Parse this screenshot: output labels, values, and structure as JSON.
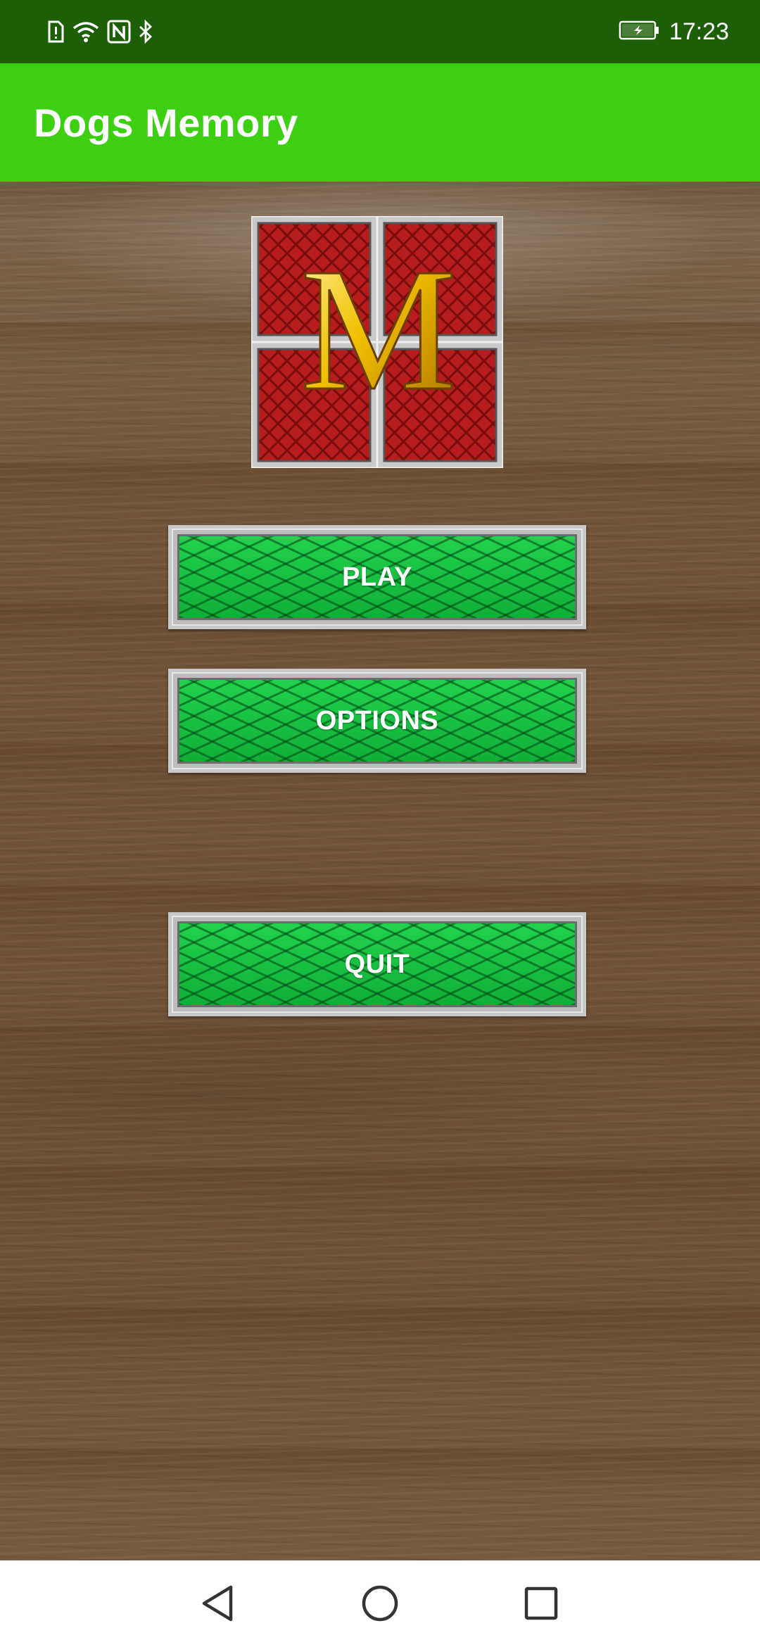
{
  "status_bar": {
    "time": "17:23",
    "icons": [
      "sim-alert-icon",
      "wifi-icon",
      "nfc-icon",
      "bluetooth-icon",
      "battery-charging-icon"
    ],
    "background_color": "#1d5f06"
  },
  "app_bar": {
    "title": "Dogs Memory",
    "background_color": "#3ccf12"
  },
  "logo": {
    "letter": "M",
    "card_color": "#b51c1c",
    "letter_color": "#f2c200"
  },
  "menu": {
    "play_label": "PLAY",
    "options_label": "OPTIONS",
    "quit_label": "QUIT",
    "button_color": "#15c23f"
  },
  "nav_bar": {
    "icons": [
      "back-icon",
      "home-icon",
      "recent-apps-icon"
    ]
  }
}
